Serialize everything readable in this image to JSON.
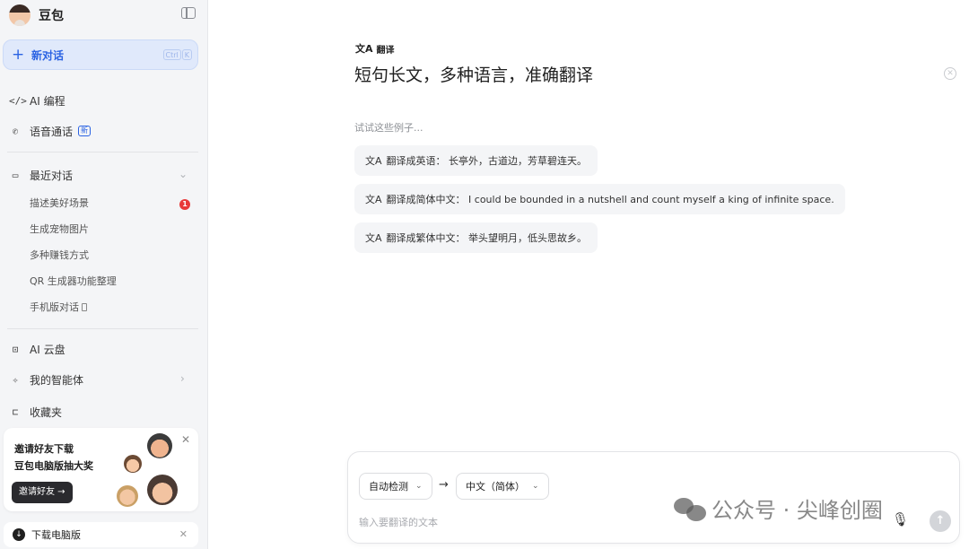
{
  "sidebar": {
    "brand": "豆包",
    "new_chat": {
      "label": "新对话",
      "shortcut": [
        "Ctrl",
        "K"
      ]
    },
    "nav": {
      "coding": {
        "label": "AI 编程",
        "icon": "code-icon"
      },
      "voice": {
        "label": "语音通话",
        "icon": "phone-icon",
        "badge": "新"
      },
      "recent": {
        "label": "最近对话",
        "icon": "chat-bubble-icon"
      }
    },
    "recent_items": [
      "描述美好场景",
      "生成宠物图片",
      "多种赚钱方式",
      "QR 生成器功能整理",
      "手机版对话"
    ],
    "recent_badge": "1",
    "bottom_nav": {
      "cloud": {
        "label": "AI 云盘",
        "icon": "cloud-drive-icon"
      },
      "agents": {
        "label": "我的智能体",
        "icon": "sparkle-icon"
      },
      "favorites": {
        "label": "收藏夹",
        "icon": "bookmark-icon"
      }
    },
    "invite": {
      "line1": "邀请好友下载",
      "line2": "豆包电脑版抽大奖",
      "button": "邀请好友 →"
    },
    "download": {
      "label": "下载电脑版"
    }
  },
  "main": {
    "tool_tag": "翻译",
    "headline": "短句长文，多种语言，准确翻译",
    "examples_hint": "试试这些例子...",
    "examples": [
      "翻译成英语： 长亭外，古道边，芳草碧连天。",
      "翻译成简体中文： I could be bounded in a nutshell and count myself a king of infinite space.",
      "翻译成繁体中文： 举头望明月，低头思故乡。"
    ],
    "input": {
      "source_lang": "自动检测",
      "target_lang": "中文（简体）",
      "placeholder": "输入要翻译的文本"
    },
    "watermark": "公众号 · 尖峰创圈"
  },
  "colors": {
    "accent": "#2b63e3",
    "sidebar_bg": "#f4f5f7",
    "badge_red": "#e83a3a"
  }
}
